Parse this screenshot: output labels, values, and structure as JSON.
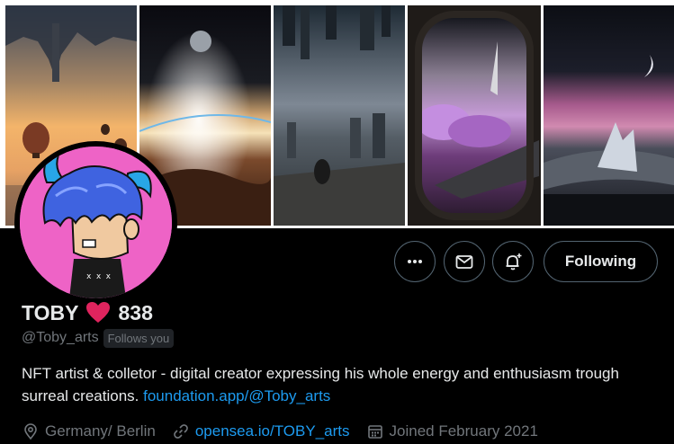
{
  "profile": {
    "name": "TOBY",
    "name_suffix_icon": "red-heart-icon",
    "name_number": "838",
    "handle": "@Toby_arts",
    "follows_you": "Follows you",
    "bio_text": "NFT artist & colletor - digital creator expressing his whole energy and enthusiasm trough surreal creations. ",
    "bio_link": "foundation.app/@Toby_arts",
    "location": "Germany/ Berlin",
    "website": "opensea.io/TOBY_arts",
    "joined": "Joined February 2021"
  },
  "actions": {
    "more_icon": "more-icon",
    "message_icon": "mail-icon",
    "notify_icon": "bell-plus-icon",
    "follow_label": "Following"
  },
  "icons": {
    "location": "location-pin-icon",
    "website": "link-icon",
    "joined": "calendar-icon"
  },
  "colors": {
    "background": "#000000",
    "text": "#e7e9ea",
    "muted": "#71767b",
    "link": "#1d9bf0",
    "heart": "#e0245e",
    "avatar_bg": "#ee63c6"
  }
}
